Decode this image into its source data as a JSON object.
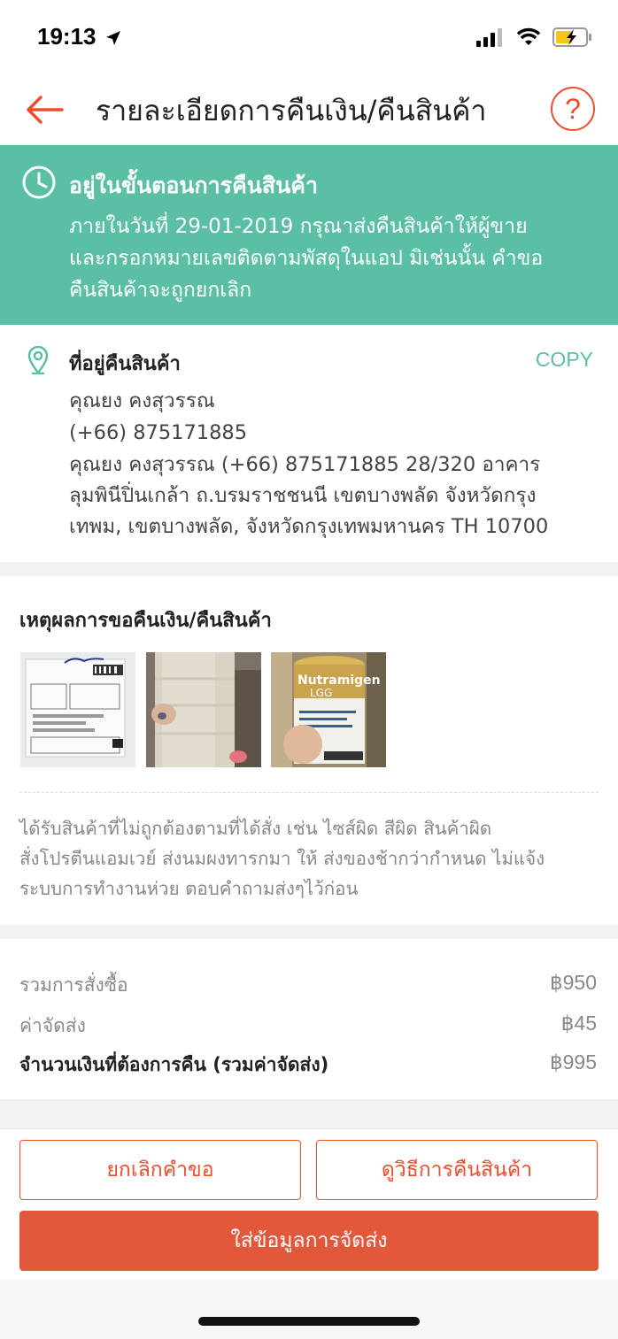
{
  "status_bar": {
    "time": "19:13"
  },
  "header": {
    "title": "รายละเอียดการคืนเงิน/คืนสินค้า",
    "help_label": "?"
  },
  "banner": {
    "title": "อยู่ในขั้นตอนการคืนสินค้า",
    "lines": [
      "ภายในวันที่ 29-01-2019 กรุณาส่งคืนสินค้าให้ผู้ขาย",
      "และกรอกหมายเลขติดตามพัสดุในแอป มิเช่นนั้น คำขอ",
      "คืนสินค้าจะถูกยกเลิก"
    ]
  },
  "return_address": {
    "title": "ที่อยู่คืนสินค้า",
    "copy_label": "COPY",
    "name": "คุณยง คงสุวรรณ",
    "phone": "(+66) 875171885",
    "address_lines": [
      "คุณยง คงสุวรรณ (+66) 875171885 28/320 อาคาร",
      "ลุมพินีปิ่นเกล้า ถ.บรมราชชนนี เขตบางพลัด จังหวัดกรุง",
      "เทพม, เขตบางพลัด, จังหวัดกรุงเทพมหานคร TH 10700"
    ]
  },
  "reason": {
    "title": "เหตุผลการขอคืนเงิน/คืนสินค้า",
    "photo_can_text": "Nutramigen",
    "photo_can_sub": "LGG",
    "lines": [
      "ได้รับสินค้าที่ไม่ถูกต้องตามที่ได้สั่ง เช่น ไซส์ผิด สีผิด สินค้าผิด",
      "สั่งโปรตีนแอมเวย์ ส่งนมผงทารกมา ให้ ส่งของช้ากว่ากำหนด ไม่แจ้ง",
      "ระบบการทำงานห่วย ตอบคำถามส่งๆไว้ก่อน"
    ]
  },
  "summary": {
    "order_total_label": "รวมการสั่งซื้อ",
    "order_total_value": "฿950",
    "shipping_label": "ค่าจัดส่ง",
    "shipping_value": "฿45",
    "refund_label": "จำนวนเงินที่ต้องการคืน (รวมค่าจัดส่ง)",
    "refund_value": "฿995"
  },
  "actions": {
    "cancel_label": "ยกเลิกคำขอ",
    "how_to_label": "ดูวิธีการคืนสินค้า",
    "shipping_info_label": "ใส่ข้อมูลการจัดส่ง"
  },
  "colors": {
    "accent": "#ee4d2d",
    "teal": "#5bbfa5",
    "primary_button": "#e2583a"
  }
}
